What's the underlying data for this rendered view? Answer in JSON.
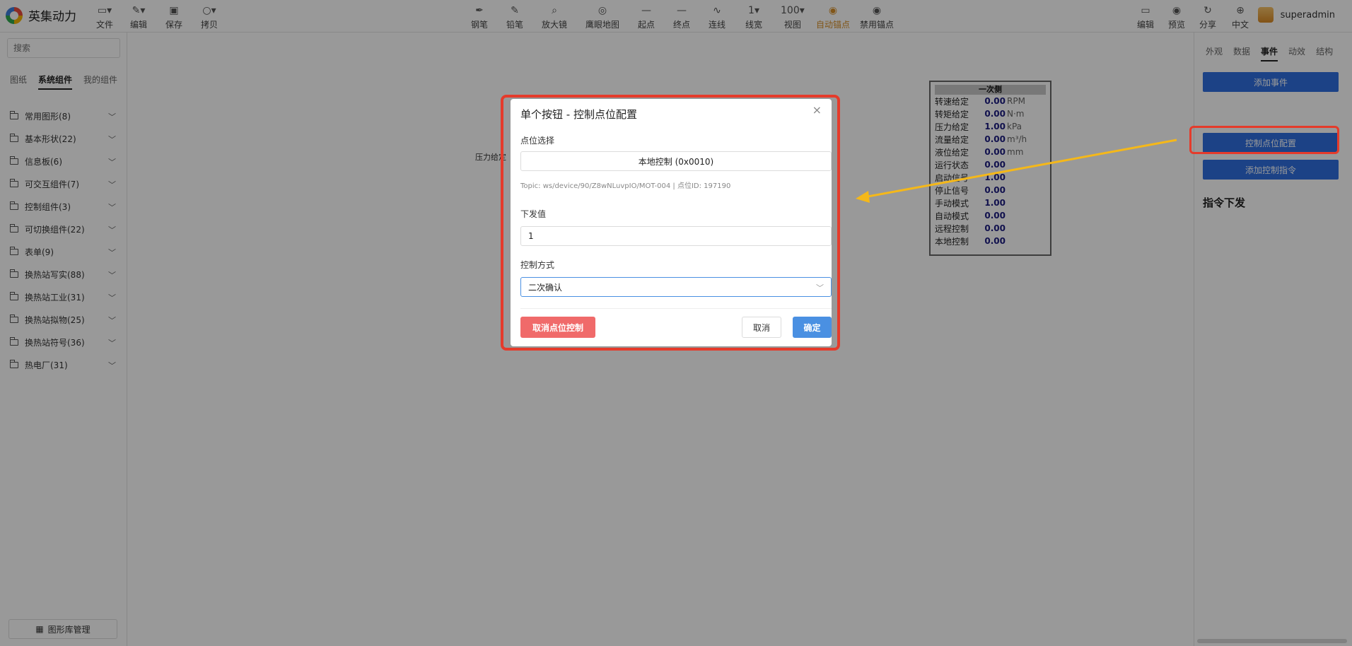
{
  "app": {
    "name": "英集动力"
  },
  "toolbar": {
    "left": [
      {
        "id": "file",
        "label": "文件",
        "icon": "folder-icon"
      },
      {
        "id": "edit",
        "label": "编辑",
        "icon": "edit-icon"
      },
      {
        "id": "save",
        "label": "保存",
        "icon": "save-icon"
      },
      {
        "id": "copy",
        "label": "拷贝",
        "icon": "copy-icon"
      }
    ],
    "center": [
      {
        "id": "pen",
        "label": "钢笔",
        "glyph": "✒"
      },
      {
        "id": "pencil",
        "label": "铅笔",
        "glyph": "✎"
      },
      {
        "id": "magnifier",
        "label": "放大镜",
        "glyph": "⌕"
      },
      {
        "id": "eagle-map",
        "label": "鹰眼地图",
        "glyph": "◎"
      },
      {
        "id": "start-point",
        "label": "起点",
        "glyph": "—"
      },
      {
        "id": "end-point",
        "label": "终点",
        "glyph": "—"
      },
      {
        "id": "connect",
        "label": "连线",
        "glyph": "∿"
      },
      {
        "id": "line-width",
        "label": "线宽",
        "glyph": "1▾"
      },
      {
        "id": "view",
        "label": "视图",
        "glyph": "100▾"
      },
      {
        "id": "auto-anchor",
        "label": "自动锚点",
        "glyph": "◉"
      },
      {
        "id": "disable-anchor",
        "label": "禁用锚点",
        "glyph": "◉"
      }
    ],
    "right": [
      {
        "id": "edit-right",
        "label": "编辑",
        "glyph": "▭"
      },
      {
        "id": "preview",
        "label": "预览",
        "glyph": "◉"
      },
      {
        "id": "share",
        "label": "分享",
        "glyph": "↻"
      },
      {
        "id": "language",
        "label": "中文",
        "glyph": "⊕"
      }
    ],
    "username": "superadmin",
    "accent": "#d7902a"
  },
  "sidebar": {
    "search_placeholder": "搜索",
    "tabs": [
      "图纸",
      "系统组件",
      "我的组件"
    ],
    "active_tab": "系统组件",
    "categories": [
      "常用图形(8)",
      "基本形状(22)",
      "信息板(6)",
      "可交互组件(7)",
      "控制组件(3)",
      "可切换组件(22)",
      "表单(9)",
      "换热站写实(88)",
      "换热站工业(31)",
      "换热站拟物(25)",
      "换热站符号(36)",
      "热电厂(31)"
    ],
    "library_button": "图形库管理"
  },
  "canvas": {
    "text": "压力给定",
    "table": {
      "title": "一次侧",
      "rows": [
        {
          "key": "转速给定",
          "value": "0.00",
          "unit": "RPM"
        },
        {
          "key": "转矩给定",
          "value": "0.00",
          "unit": "N·m"
        },
        {
          "key": "压力给定",
          "value": "1.00",
          "unit": "kPa"
        },
        {
          "key": "流量给定",
          "value": "0.00",
          "unit": "m³/h"
        },
        {
          "key": "液位给定",
          "value": "0.00",
          "unit": "mm"
        },
        {
          "key": "运行状态",
          "value": "0.00",
          "unit": ""
        },
        {
          "key": "启动信号",
          "value": "1.00",
          "unit": ""
        },
        {
          "key": "停止信号",
          "value": "0.00",
          "unit": ""
        },
        {
          "key": "手动模式",
          "value": "1.00",
          "unit": ""
        },
        {
          "key": "自动模式",
          "value": "0.00",
          "unit": ""
        },
        {
          "key": "远程控制",
          "value": "0.00",
          "unit": ""
        },
        {
          "key": "本地控制",
          "value": "0.00",
          "unit": ""
        }
      ]
    }
  },
  "right_panel": {
    "tabs": [
      "外观",
      "数据",
      "事件",
      "动效",
      "结构"
    ],
    "active_tab": "事件",
    "add_event": "添加事件",
    "control_point_config": "控制点位配置",
    "add_control_command": "添加控制指令",
    "section_title": "指令下发"
  },
  "modal": {
    "title": "单个按钮 - 控制点位配置",
    "point_label": "点位选择",
    "point_value": "本地控制 (0x0010)",
    "topic": "Topic: ws/device/90/Z8wNLuvpIO/MOT-004 | 点位ID: 197190",
    "value_label": "下发值",
    "value": "1",
    "mode_label": "控制方式",
    "mode_value": "二次确认",
    "cancel_point_button": "取消点位控制",
    "cancel_button": "取消",
    "ok_button": "确定"
  },
  "annotation": {
    "highlight_color": "#e53b2b",
    "arrow_color": "#f5b819"
  }
}
